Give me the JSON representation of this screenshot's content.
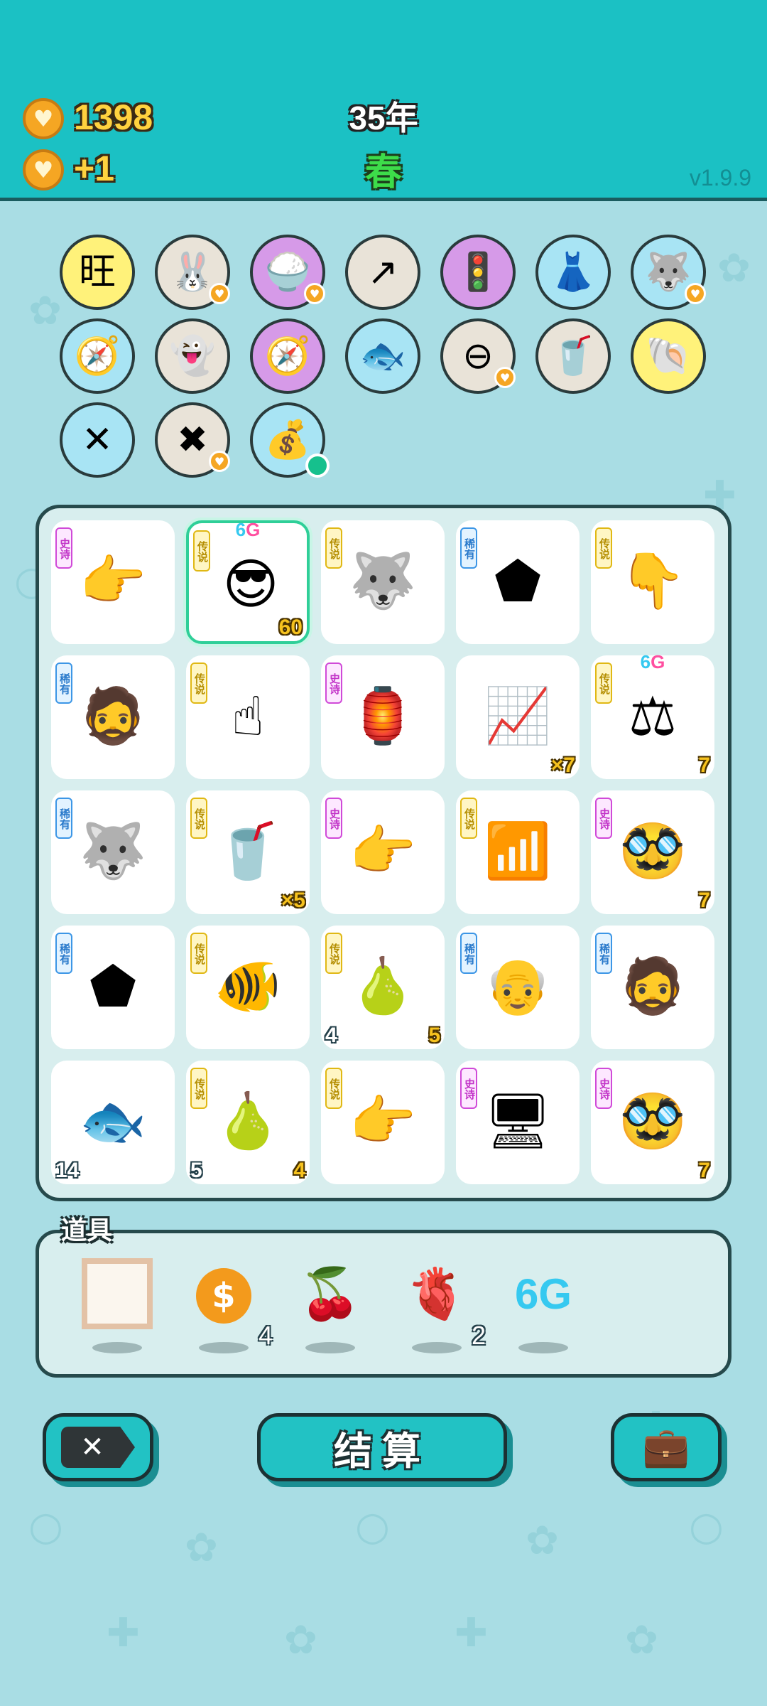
{
  "header": {
    "coins": "1398",
    "coin_rate": "+1",
    "year": "35年",
    "season": "春",
    "version": "v1.9.9"
  },
  "symbols": [
    {
      "icon": "wang-tiles-icon",
      "glyph": "旺",
      "bg": "#fff27a",
      "badge": null
    },
    {
      "icon": "rabbit-icon",
      "glyph": "🐰",
      "bg": "#e9e3d8",
      "badge": "heart"
    },
    {
      "icon": "rice-bowl-icon",
      "glyph": "🍚",
      "bg": "#d69ae8",
      "badge": "heart"
    },
    {
      "icon": "growth-arrow-icon",
      "glyph": "↗",
      "bg": "#e9e3d8",
      "badge": null
    },
    {
      "icon": "traffic-light-icon",
      "glyph": "🚦",
      "bg": "#d69ae8",
      "badge": null
    },
    {
      "icon": "skirt-icon",
      "glyph": "👗",
      "bg": "#a8e4f4",
      "badge": null
    },
    {
      "icon": "husky-dog-icon",
      "glyph": "🐺",
      "bg": "#a8e4f4",
      "badge": "heart"
    },
    {
      "icon": "compass-icon",
      "glyph": "🧭",
      "bg": "#a8e4f4",
      "badge": null
    },
    {
      "icon": "ghost-icon",
      "glyph": "👻",
      "bg": "#e9e3d8",
      "badge": null
    },
    {
      "icon": "compass-icon",
      "glyph": "🧭",
      "bg": "#d69ae8",
      "badge": null
    },
    {
      "icon": "fish-bowl-icon",
      "glyph": "🐟",
      "bg": "#a8e4f4",
      "badge": null
    },
    {
      "icon": "no-entry-icon",
      "glyph": "⊖",
      "bg": "#e9e3d8",
      "badge": "heart"
    },
    {
      "icon": "bubble-tea-icon",
      "glyph": "🥤",
      "bg": "#e9e3d8",
      "badge": null
    },
    {
      "icon": "shell-icon",
      "glyph": "🐚",
      "bg": "#fff27a",
      "badge": null
    },
    {
      "icon": "chopsticks-icon",
      "glyph": "✕",
      "bg": "#a8e4f4",
      "badge": null
    },
    {
      "icon": "delete-tag-icon",
      "glyph": "✖",
      "bg": "#e9e3d8",
      "badge": "heart"
    },
    {
      "icon": "sack-icon",
      "glyph": "💰",
      "bg": "#a8e4f4",
      "badge": "dot"
    }
  ],
  "board": [
    {
      "tag": "史诗",
      "tagtype": "epic",
      "icon": "pointing-hand-gray-icon",
      "glyph": "👉",
      "br": "",
      "bl": "",
      "top": false,
      "sel": false
    },
    {
      "tag": "传说",
      "tagtype": "legend",
      "icon": "sunglasses-man-icon",
      "glyph": "😎",
      "br": "60",
      "bl": "",
      "top": true,
      "sel": true
    },
    {
      "tag": "传说",
      "tagtype": "legend",
      "icon": "husky-king-icon",
      "glyph": "🐺",
      "br": "",
      "bl": "",
      "top": false,
      "sel": false
    },
    {
      "tag": "稀有",
      "tagtype": "rare",
      "icon": "gold-pentagon-icon",
      "glyph": "⬟",
      "br": "",
      "bl": "",
      "top": false,
      "sel": false
    },
    {
      "tag": "传说",
      "tagtype": "legend",
      "icon": "pointing-hand-gold-icon",
      "glyph": "👇",
      "br": "",
      "bl": "",
      "top": false,
      "sel": false
    },
    {
      "tag": "稀有",
      "tagtype": "rare",
      "icon": "bucket-hat-man-icon",
      "glyph": "🧔",
      "br": "",
      "bl": "",
      "top": false,
      "sel": false
    },
    {
      "tag": "传说",
      "tagtype": "legend",
      "icon": "pointing-up-hand-icon",
      "glyph": "☝",
      "br": "",
      "bl": "",
      "top": false,
      "sel": false
    },
    {
      "tag": "史诗",
      "tagtype": "epic",
      "icon": "rabbit-house-icon",
      "glyph": "🏮",
      "br": "",
      "bl": "",
      "top": false,
      "sel": false
    },
    {
      "tag": "",
      "tagtype": "",
      "icon": "growth-chart-icon",
      "glyph": "📈",
      "br": "×7",
      "bl": "",
      "top": false,
      "sel": false
    },
    {
      "tag": "传说",
      "tagtype": "legend",
      "icon": "balance-scale-icon",
      "glyph": "⚖",
      "br": "7",
      "bl": "",
      "top": true,
      "sel": false
    },
    {
      "tag": "稀有",
      "tagtype": "rare",
      "icon": "husky-dog-icon",
      "glyph": "🐺",
      "br": "",
      "bl": "",
      "top": false,
      "sel": false
    },
    {
      "tag": "传说",
      "tagtype": "legend",
      "icon": "bubble-tea-icon",
      "glyph": "🥤",
      "br": "×5",
      "bl": "",
      "top": false,
      "sel": false
    },
    {
      "tag": "史诗",
      "tagtype": "epic",
      "icon": "pointing-hand-gray-icon",
      "glyph": "👉",
      "br": "",
      "bl": "",
      "top": false,
      "sel": false
    },
    {
      "tag": "传说",
      "tagtype": "legend",
      "icon": "wifi-icon",
      "glyph": "📶",
      "br": "",
      "bl": "",
      "top": false,
      "sel": false
    },
    {
      "tag": "史诗",
      "tagtype": "epic",
      "icon": "green-hat-man-icon",
      "glyph": "🥸",
      "br": "7",
      "bl": "",
      "top": false,
      "sel": false
    },
    {
      "tag": "稀有",
      "tagtype": "rare",
      "icon": "wood-pentagon-icon",
      "glyph": "⬟",
      "br": "",
      "bl": "",
      "top": false,
      "sel": false
    },
    {
      "tag": "传说",
      "tagtype": "legend",
      "icon": "koi-fish-icon",
      "glyph": "🐠",
      "br": "",
      "bl": "",
      "top": false,
      "sel": false
    },
    {
      "tag": "传说",
      "tagtype": "legend",
      "icon": "pear-icon",
      "glyph": "🍐",
      "br": "5",
      "bl": "4",
      "top": false,
      "sel": false
    },
    {
      "tag": "稀有",
      "tagtype": "rare",
      "icon": "bald-man-icon",
      "glyph": "👴",
      "br": "",
      "bl": "",
      "top": false,
      "sel": false
    },
    {
      "tag": "稀有",
      "tagtype": "rare",
      "icon": "bucket-hat-man-icon",
      "glyph": "🧔",
      "br": "",
      "bl": "",
      "top": false,
      "sel": false
    },
    {
      "tag": "",
      "tagtype": "",
      "icon": "goldfish-icon",
      "glyph": "🐟",
      "br": "",
      "bl": "14",
      "top": false,
      "sel": false
    },
    {
      "tag": "传说",
      "tagtype": "legend",
      "icon": "pear-icon",
      "glyph": "🍐",
      "br": "4",
      "bl": "5",
      "top": false,
      "sel": false
    },
    {
      "tag": "传说",
      "tagtype": "legend",
      "icon": "pointing-hand-gold-icon",
      "glyph": "👉",
      "br": "",
      "bl": "",
      "top": false,
      "sel": false
    },
    {
      "tag": "史诗",
      "tagtype": "epic",
      "icon": "graphics-card-icon",
      "glyph": "🖥",
      "br": "",
      "bl": "",
      "top": false,
      "sel": false
    },
    {
      "tag": "史诗",
      "tagtype": "epic",
      "icon": "green-hat-man-icon",
      "glyph": "🥸",
      "br": "7",
      "bl": "",
      "top": false,
      "sel": false
    }
  ],
  "badge_6g": {
    "a": "6",
    "b": "G"
  },
  "items_panel": {
    "title": "道具",
    "items": [
      {
        "icon": "picture-frame-icon",
        "glyph": "▢",
        "count": ""
      },
      {
        "icon": "dollar-coin-icon",
        "glyph": "$",
        "count": "4"
      },
      {
        "icon": "lychee-icon",
        "glyph": "🍒",
        "count": ""
      },
      {
        "icon": "liver-icon",
        "glyph": "🫀",
        "count": "2"
      },
      {
        "icon": "six-g-icon",
        "glyph": "6G",
        "count": ""
      }
    ]
  },
  "buttons": {
    "settle_label": "结算"
  },
  "colors": {
    "header_bg": "#1bc1c4",
    "page_bg": "#a9dde4",
    "button_bg": "#22c2c4"
  }
}
